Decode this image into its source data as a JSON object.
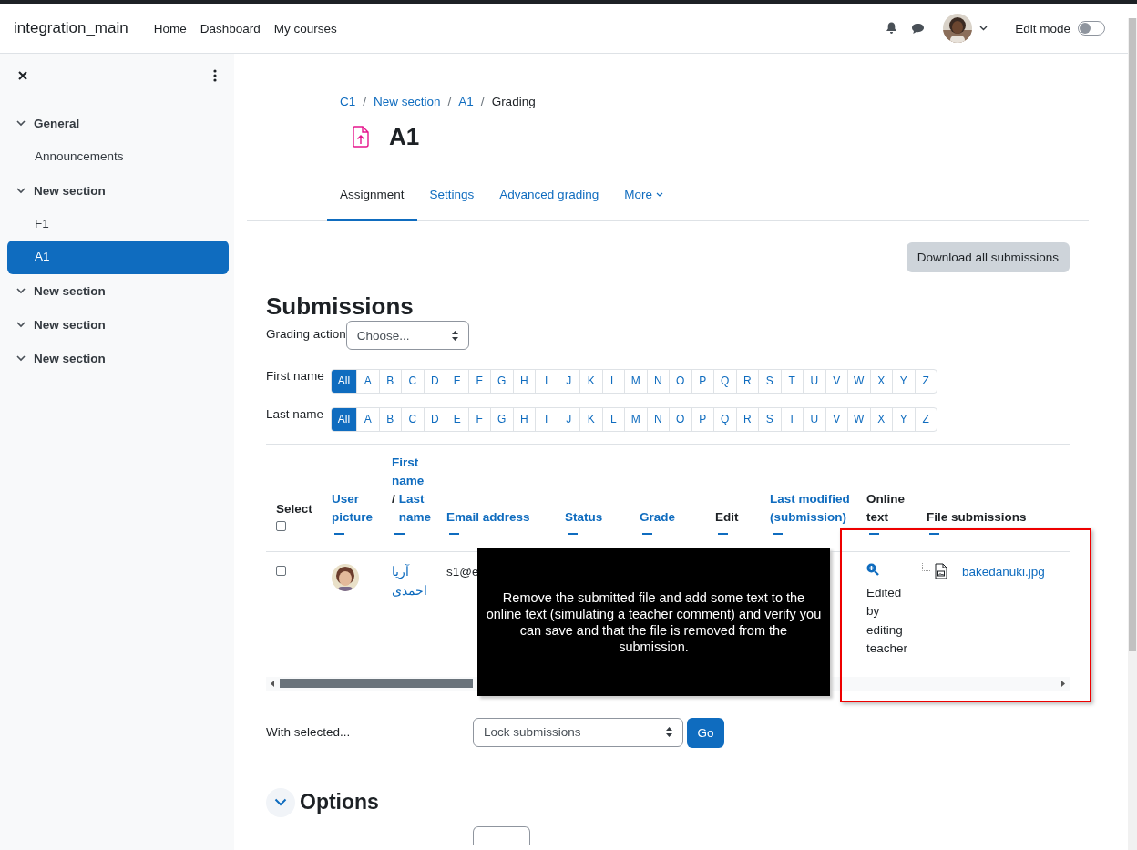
{
  "navbar": {
    "site_name": "integration_main",
    "links": [
      {
        "label": "Home"
      },
      {
        "label": "Dashboard"
      },
      {
        "label": "My courses"
      }
    ],
    "edit_mode": {
      "label": "Edit mode",
      "on": false
    }
  },
  "sidebar": {
    "items": [
      {
        "label": "General",
        "expanded": true,
        "selected": false,
        "children": [
          {
            "label": "Announcements",
            "selected": false
          }
        ]
      },
      {
        "label": "New section",
        "expanded": true,
        "selected": false,
        "children": [
          {
            "label": "F1",
            "selected": false
          },
          {
            "label": "A1",
            "selected": true
          }
        ]
      },
      {
        "label": "New section",
        "expanded": true,
        "selected": false
      },
      {
        "label": "New section",
        "expanded": true,
        "selected": false
      },
      {
        "label": "New section",
        "expanded": true,
        "selected": false
      }
    ]
  },
  "breadcrumb": {
    "separator": "/",
    "items": [
      {
        "label": "C1",
        "link": true
      },
      {
        "label": "New section",
        "link": true
      },
      {
        "label": "A1",
        "link": true
      },
      {
        "label": "Grading",
        "link": false
      }
    ]
  },
  "page_title": "A1",
  "tabs": [
    {
      "label": "Assignment",
      "selected": true
    },
    {
      "label": "Settings",
      "selected": false
    },
    {
      "label": "Advanced grading",
      "selected": false
    },
    {
      "label": "More",
      "selected": false
    }
  ],
  "download_button": "Download all submissions",
  "heading": "Submissions",
  "grading_action": {
    "label": "Grading action",
    "value": "Choose..."
  },
  "filters": [
    {
      "label": "First name",
      "letters": [
        {
          "label": "All",
          "selected": true
        },
        {
          "label": "A",
          "selected": false
        },
        {
          "label": "B",
          "selected": false
        },
        {
          "label": "C",
          "selected": false
        },
        {
          "label": "D",
          "selected": false
        },
        {
          "label": "E",
          "selected": false
        },
        {
          "label": "F",
          "selected": false
        },
        {
          "label": "G",
          "selected": false
        },
        {
          "label": "H",
          "selected": false
        },
        {
          "label": "I",
          "selected": false
        },
        {
          "label": "J",
          "selected": false
        },
        {
          "label": "K",
          "selected": false
        },
        {
          "label": "L",
          "selected": false
        },
        {
          "label": "M",
          "selected": false
        },
        {
          "label": "N",
          "selected": false
        },
        {
          "label": "O",
          "selected": false
        },
        {
          "label": "P",
          "selected": false
        },
        {
          "label": "Q",
          "selected": false
        },
        {
          "label": "R",
          "selected": false
        },
        {
          "label": "S",
          "selected": false
        },
        {
          "label": "T",
          "selected": false
        },
        {
          "label": "U",
          "selected": false
        },
        {
          "label": "V",
          "selected": false
        },
        {
          "label": "W",
          "selected": false
        },
        {
          "label": "X",
          "selected": false
        },
        {
          "label": "Y",
          "selected": false
        },
        {
          "label": "Z",
          "selected": false
        }
      ]
    },
    {
      "label": "Last name",
      "letters": [
        {
          "label": "All",
          "selected": true
        },
        {
          "label": "A",
          "selected": false
        },
        {
          "label": "B",
          "selected": false
        },
        {
          "label": "C",
          "selected": false
        },
        {
          "label": "D",
          "selected": false
        },
        {
          "label": "E",
          "selected": false
        },
        {
          "label": "F",
          "selected": false
        },
        {
          "label": "G",
          "selected": false
        },
        {
          "label": "H",
          "selected": false
        },
        {
          "label": "I",
          "selected": false
        },
        {
          "label": "J",
          "selected": false
        },
        {
          "label": "K",
          "selected": false
        },
        {
          "label": "L",
          "selected": false
        },
        {
          "label": "M",
          "selected": false
        },
        {
          "label": "N",
          "selected": false
        },
        {
          "label": "O",
          "selected": false
        },
        {
          "label": "P",
          "selected": false
        },
        {
          "label": "Q",
          "selected": false
        },
        {
          "label": "R",
          "selected": false
        },
        {
          "label": "S",
          "selected": false
        },
        {
          "label": "T",
          "selected": false
        },
        {
          "label": "U",
          "selected": false
        },
        {
          "label": "V",
          "selected": false
        },
        {
          "label": "W",
          "selected": false
        },
        {
          "label": "X",
          "selected": false
        },
        {
          "label": "Y",
          "selected": false
        },
        {
          "label": "Z",
          "selected": false
        }
      ]
    }
  ],
  "table": {
    "columns": [
      {
        "kind": "select",
        "label": "Select",
        "sortable": false,
        "checked": false
      },
      {
        "kind": "text",
        "label": "User picture",
        "sortable": true
      },
      {
        "kind": "name",
        "label": "First name",
        "separator": "/",
        "label_2": "Last name",
        "sortable": true
      },
      {
        "kind": "text",
        "label": "Email address",
        "sortable": true
      },
      {
        "kind": "text",
        "label": "Status",
        "sortable": true
      },
      {
        "kind": "text",
        "label": "Grade",
        "sortable": true
      },
      {
        "kind": "text",
        "label": "Edit",
        "sortable": false
      },
      {
        "kind": "text",
        "label": "Last modified (submission)",
        "sortable": true
      },
      {
        "kind": "text",
        "label": "Online text",
        "sortable": false
      },
      {
        "kind": "text",
        "label": "File submissions",
        "sortable": false
      }
    ],
    "rows": [
      {
        "selected": false,
        "first_name": "آریا",
        "last_name": "احمدی",
        "email": "s1@e",
        "online_text": "Edited by editing teacher",
        "file": "bakedanuki.jpg"
      }
    ]
  },
  "tooltip": "Remove the submitted file and add some text to the online text (simulating a teacher comment) and verify you can save and that the file is removed from the submission.",
  "with_selected": {
    "label": "With selected...",
    "value": "Lock submissions",
    "button": "Go"
  },
  "options": {
    "heading": "Options",
    "expanded": true
  }
}
